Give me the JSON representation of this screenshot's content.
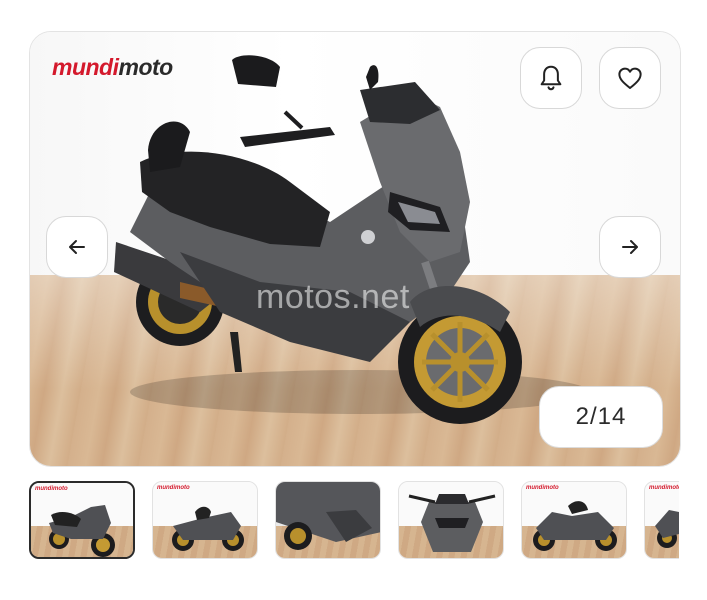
{
  "gallery": {
    "brand_logo_primary": "mundi",
    "brand_logo_secondary": "moto",
    "watermark": "motos.net",
    "counter": "2/14",
    "buttons": {
      "alert_icon": "bell-icon",
      "favorite_icon": "heart-icon",
      "prev_icon": "arrow-left-icon",
      "next_icon": "arrow-right-icon"
    }
  },
  "thumbnails": [
    {
      "logo": "mundimoto",
      "active": true
    },
    {
      "logo": "mundimoto",
      "active": false
    },
    {
      "logo": "",
      "active": false
    },
    {
      "logo": "",
      "active": false
    },
    {
      "logo": "mundimoto",
      "active": false
    },
    {
      "logo": "mundimoto",
      "active": false
    }
  ],
  "colors": {
    "brand_red": "#d4192c",
    "scooter_body": "#5c5d60",
    "wheel_gold": "#b8902c"
  }
}
